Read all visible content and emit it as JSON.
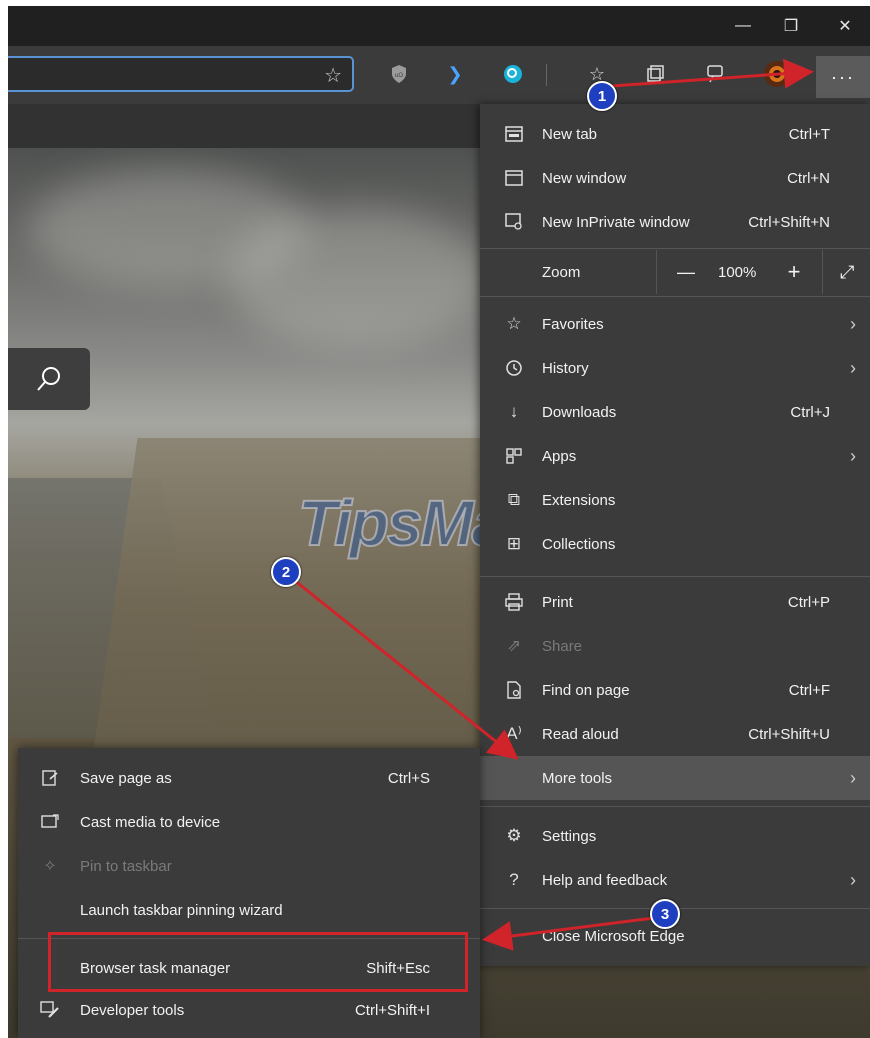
{
  "window_controls": {
    "minimize": "—",
    "maximize": "❐",
    "close": "✕"
  },
  "toolbar": {
    "more_label": "···"
  },
  "main_menu": {
    "new_tab": {
      "label": "New tab",
      "shortcut": "Ctrl+T"
    },
    "new_window": {
      "label": "New window",
      "shortcut": "Ctrl+N"
    },
    "new_inprivate": {
      "label": "New InPrivate window",
      "shortcut": "Ctrl+Shift+N"
    },
    "zoom": {
      "label": "Zoom",
      "minus": "—",
      "value": "100%",
      "plus": "+"
    },
    "favorites": {
      "label": "Favorites"
    },
    "history": {
      "label": "History"
    },
    "downloads": {
      "label": "Downloads",
      "shortcut": "Ctrl+J"
    },
    "apps": {
      "label": "Apps"
    },
    "extensions": {
      "label": "Extensions"
    },
    "collections": {
      "label": "Collections"
    },
    "print": {
      "label": "Print",
      "shortcut": "Ctrl+P"
    },
    "share": {
      "label": "Share"
    },
    "find_on_page": {
      "label": "Find on page",
      "shortcut": "Ctrl+F"
    },
    "read_aloud": {
      "label": "Read aloud",
      "shortcut": "Ctrl+Shift+U"
    },
    "more_tools": {
      "label": "More tools"
    },
    "settings": {
      "label": "Settings"
    },
    "help_feedback": {
      "label": "Help and feedback"
    },
    "close_edge": {
      "label": "Close Microsoft Edge"
    }
  },
  "sub_menu": {
    "save_page_as": {
      "label": "Save page as",
      "shortcut": "Ctrl+S"
    },
    "cast_media": {
      "label": "Cast media to device"
    },
    "pin_taskbar": {
      "label": "Pin to taskbar"
    },
    "launch_wizard": {
      "label": "Launch taskbar pinning wizard"
    },
    "task_manager": {
      "label": "Browser task manager",
      "shortcut": "Shift+Esc"
    },
    "developer_tools": {
      "label": "Developer tools",
      "shortcut": "Ctrl+Shift+I"
    }
  },
  "annotations": {
    "step1": "1",
    "step2": "2",
    "step3": "3"
  },
  "watermark": "TipsMake",
  "colors": {
    "menu_bg": "#3b3b3b",
    "highlight": "#555555",
    "annotation_red": "#d0232a",
    "badge_blue": "#1e3fbf"
  }
}
